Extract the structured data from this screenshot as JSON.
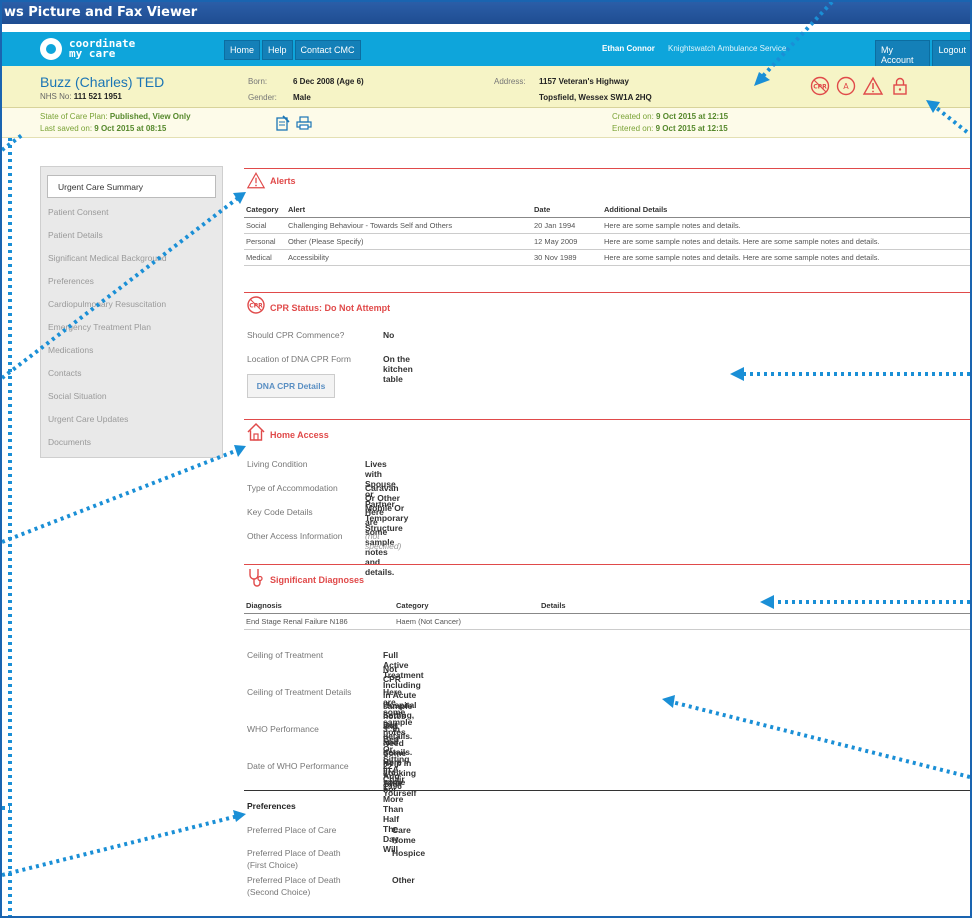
{
  "window": {
    "title": "ws Picture and Fax Viewer"
  },
  "nav": {
    "logo_line1": "coordinate",
    "logo_line2": "my care",
    "buttons": [
      "Home",
      "Help",
      "Contact CMC"
    ],
    "user": "Ethan Connor",
    "organisation": "Knightswatch Ambulance Service",
    "my_account": "My Account",
    "logout": "Logout"
  },
  "patient": {
    "name": "Buzz (Charles) TED",
    "nhs_label": "NHS No:",
    "nhs_value": "111 521 1951",
    "born_label": "Born:",
    "born_value": "6 Dec 2008 (Age 6)",
    "gender_label": "Gender:",
    "gender_value": "Male",
    "address_label": "Address:",
    "address_line1": "1157 Veteran's Highway",
    "address_line2": "Topsfield, Wessex SW1A 2HQ"
  },
  "status": {
    "state_label": "State of Care Plan:",
    "state_value": "Published, View Only",
    "saved_label": "Last saved on:",
    "saved_value": "9 Oct 2015 at 08:15",
    "created_label": "Created on:",
    "created_value": "9 Oct 2015 at 12:15",
    "entered_label": "Entered on:",
    "entered_value": "9 Oct 2015 at 12:15"
  },
  "sidebar": {
    "items": [
      "Urgent Care Summary",
      "Patient Consent",
      "Patient Details",
      "Significant Medical Background",
      "Preferences",
      "Cardiopulmonary Resuscitation",
      "Emergency Treatment Plan",
      "Medications",
      "Contacts",
      "Social Situation",
      "Urgent Care Updates",
      "Documents"
    ]
  },
  "alerts": {
    "title": "Alerts",
    "headers": [
      "Category",
      "Alert",
      "Date",
      "Additional Details"
    ],
    "rows": [
      [
        "Social",
        "Challenging Behaviour - Towards Self and Others",
        "20 Jan 1994",
        "Here are some sample notes and details."
      ],
      [
        "Personal",
        "Other (Please Specify)",
        "12 May 2009",
        "Here are some sample notes and details. Here are some sample notes and details."
      ],
      [
        "Medical",
        "Accessibility",
        "30 Nov 1989",
        "Here are some sample notes and details. Here are some sample notes and details."
      ]
    ]
  },
  "cpr": {
    "icon_text": "CPR",
    "title": "CPR Status: Do Not Attempt",
    "commence_label": "Should CPR Commence?",
    "commence_value": "No",
    "location_label": "Location of DNA CPR Form",
    "location_value": "On the kitchen table",
    "details_button": "DNA CPR Details"
  },
  "home_access": {
    "title": "Home Access",
    "living_label": "Living Condition",
    "living_value": "Lives with Spouse or Partner",
    "accom_label": "Type of Accommodation",
    "accom_value": "Caravan Or Other Mobile Or Temporary Structure",
    "keycode_label": "Key Code Details",
    "keycode_value": "Here are some sample notes and details.",
    "other_label": "Other Access Information",
    "other_value": "(not specified)"
  },
  "diagnoses": {
    "title": "Significant Diagnoses",
    "headers": [
      "Diagnosis",
      "Category",
      "Details"
    ],
    "rows": [
      [
        "End Stage Renal Failure N186",
        "Haem (Not Cancer)",
        ""
      ]
    ],
    "ceiling_label": "Ceiling of Treatment",
    "ceiling_value_1": "Full Active Treatment Including in Acute Hospital Setting, But",
    "ceiling_value_2": "Not CPR",
    "ceiling_details_label": "Ceiling of Treatment Details",
    "ceiling_details_1": "Here are some sample notes and details. Here are some",
    "ceiling_details_2": "sample notes and details.",
    "who_label": "WHO Performance",
    "who_value_1": "3. In Bed Or Sitting In A Chair For More Than Half The Day. Will",
    "who_value_2": "Need Some Help In Looking After Yourself",
    "who_date_label": "Date of WHO Performance",
    "who_date_value": "22 Aug 1996"
  },
  "preferences": {
    "title": "Preferences",
    "care_label": "Preferred Place of Care",
    "care_value": "Care Home",
    "death1_label_1": "Preferred Place of Death",
    "death1_label_2": "(First Choice)",
    "death1_value": "Hospice",
    "death2_label_1": "Preferred Place of Death",
    "death2_label_2": "(Second Choice)",
    "death2_value": "Other"
  },
  "colors": {
    "accent": "#0ea5db",
    "alert_red": "#e04a4a",
    "status_green": "#55882b",
    "callout_blue": "#1a8fd6"
  }
}
